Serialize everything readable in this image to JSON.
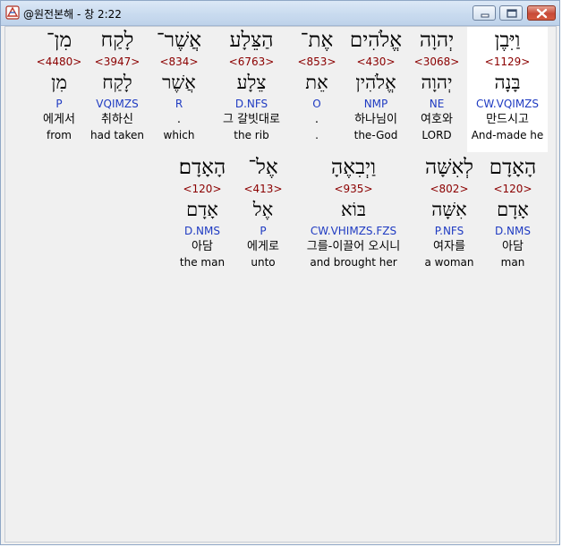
{
  "window": {
    "title": "@원전본해 - 창 2:22",
    "icon": "app-logo-icon",
    "controls": [
      "minimize-icon",
      "maximize-icon",
      "close-icon"
    ]
  },
  "colors": {
    "strong": "#8b0000",
    "morph": "#1f3bc2",
    "text": "#000000",
    "selected_bg": "#ffffff"
  },
  "verse": {
    "row1": [
      {
        "hebrew": "וַיִּבֶן",
        "strong": "<1129>",
        "root": "בָּנָה",
        "morph": "CW.VQIMZS",
        "korean": "만드시고",
        "english": "And-made he"
      },
      {
        "hebrew": "יְהוָה",
        "strong": "<3068>",
        "root": "יְהוָה",
        "morph": "NE",
        "korean": "여호와",
        "english": "LORD"
      },
      {
        "hebrew": "אֱלֹהִים",
        "strong": "<430>",
        "root": "אֱלֹהִין",
        "morph": "NMP",
        "korean": "하나님이",
        "english": "the-God"
      },
      {
        "hebrew": "אֶת־",
        "strong": "<853>",
        "root": "אֵת",
        "morph": "O",
        "korean": ".",
        "english": "."
      },
      {
        "hebrew": "הַצֵּלָע",
        "strong": "<6763>",
        "root": "צֵלָע",
        "morph": "D.NFS",
        "korean": "그 갈빗대로",
        "english": "the rib"
      },
      {
        "hebrew": "אֲשֶׁר־",
        "strong": "<834>",
        "root": "אֲשֶׁר",
        "morph": "R",
        "korean": ".",
        "english": "which"
      },
      {
        "hebrew": "לָקַח",
        "strong": "<3947>",
        "root": "לָקַח",
        "morph": "VQIMZS",
        "korean": "취하신",
        "english": "had taken"
      },
      {
        "hebrew": "מִן־",
        "strong": "<4480>",
        "root": "מִן",
        "morph": "P",
        "korean": "에게서",
        "english": "from"
      }
    ],
    "row2": [
      {
        "hebrew": "הָאָדָם",
        "strong": "<120>",
        "root": "אָדָם",
        "morph": "D.NMS",
        "korean": "아담",
        "english": "man"
      },
      {
        "hebrew": "לְאִשָּׁה",
        "strong": "<802>",
        "root": "אִשָּׁה",
        "morph": "P.NFS",
        "korean": "여자를",
        "english": "a woman"
      },
      {
        "hebrew": "וַיְבִאֶהָ",
        "strong": "<935>",
        "root": "בּוֹא",
        "morph": "CW.VHIMZS.FZS",
        "korean": "그를-이끌어 오시니",
        "english": "and brought her"
      },
      {
        "hebrew": "אֶל־",
        "strong": "<413>",
        "root": "אֶל",
        "morph": "P",
        "korean": "에게로",
        "english": "unto"
      },
      {
        "hebrew": "הָאָדָם׃",
        "strong": "<120>",
        "root": "אָדָם",
        "morph": "D.NMS",
        "korean": "아담",
        "english": "the man"
      }
    ]
  }
}
